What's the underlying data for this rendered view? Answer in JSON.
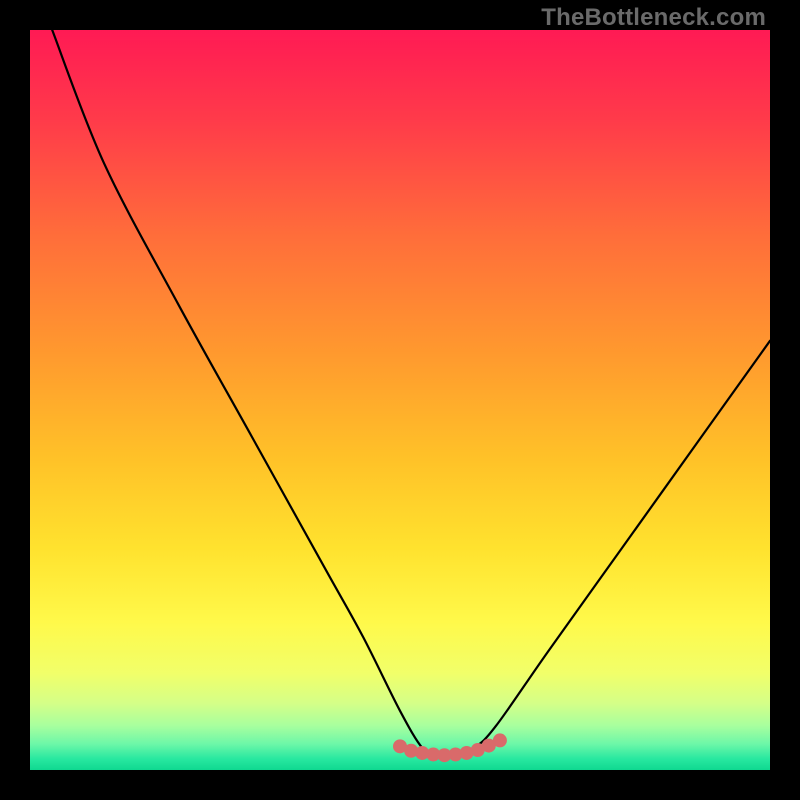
{
  "watermark": "TheBottleneck.com",
  "chart_data": {
    "type": "line",
    "title": "",
    "xlabel": "",
    "ylabel": "",
    "x_range": [
      0,
      100
    ],
    "y_range": [
      0,
      100
    ],
    "series": [
      {
        "name": "bottleneck-curve",
        "x": [
          3,
          10,
          20,
          30,
          40,
          45,
          50,
          53,
          55,
          57,
          60,
          63,
          70,
          80,
          90,
          100
        ],
        "y": [
          100,
          82,
          63,
          45,
          27,
          18,
          8,
          3,
          2,
          2,
          3,
          6,
          16,
          30,
          44,
          58
        ]
      }
    ],
    "markers": {
      "name": "flat-region-dots",
      "x": [
        50,
        51.5,
        53,
        54.5,
        56,
        57.5,
        59,
        60.5,
        62,
        63.5
      ],
      "y": [
        3.2,
        2.6,
        2.3,
        2.1,
        2.0,
        2.1,
        2.3,
        2.7,
        3.3,
        4.0
      ],
      "color": "#d96a6a",
      "radius": 7
    },
    "gradient_stops": [
      {
        "offset": 0.0,
        "color": "#ff1a54"
      },
      {
        "offset": 0.12,
        "color": "#ff3a4a"
      },
      {
        "offset": 0.28,
        "color": "#ff6e3a"
      },
      {
        "offset": 0.44,
        "color": "#ff9a2e"
      },
      {
        "offset": 0.58,
        "color": "#ffc228"
      },
      {
        "offset": 0.7,
        "color": "#ffe22e"
      },
      {
        "offset": 0.8,
        "color": "#fff94a"
      },
      {
        "offset": 0.87,
        "color": "#f1ff6a"
      },
      {
        "offset": 0.91,
        "color": "#d4ff88"
      },
      {
        "offset": 0.94,
        "color": "#a8ff9e"
      },
      {
        "offset": 0.965,
        "color": "#6cf7a8"
      },
      {
        "offset": 0.985,
        "color": "#28e8a0"
      },
      {
        "offset": 1.0,
        "color": "#0fd890"
      }
    ]
  }
}
